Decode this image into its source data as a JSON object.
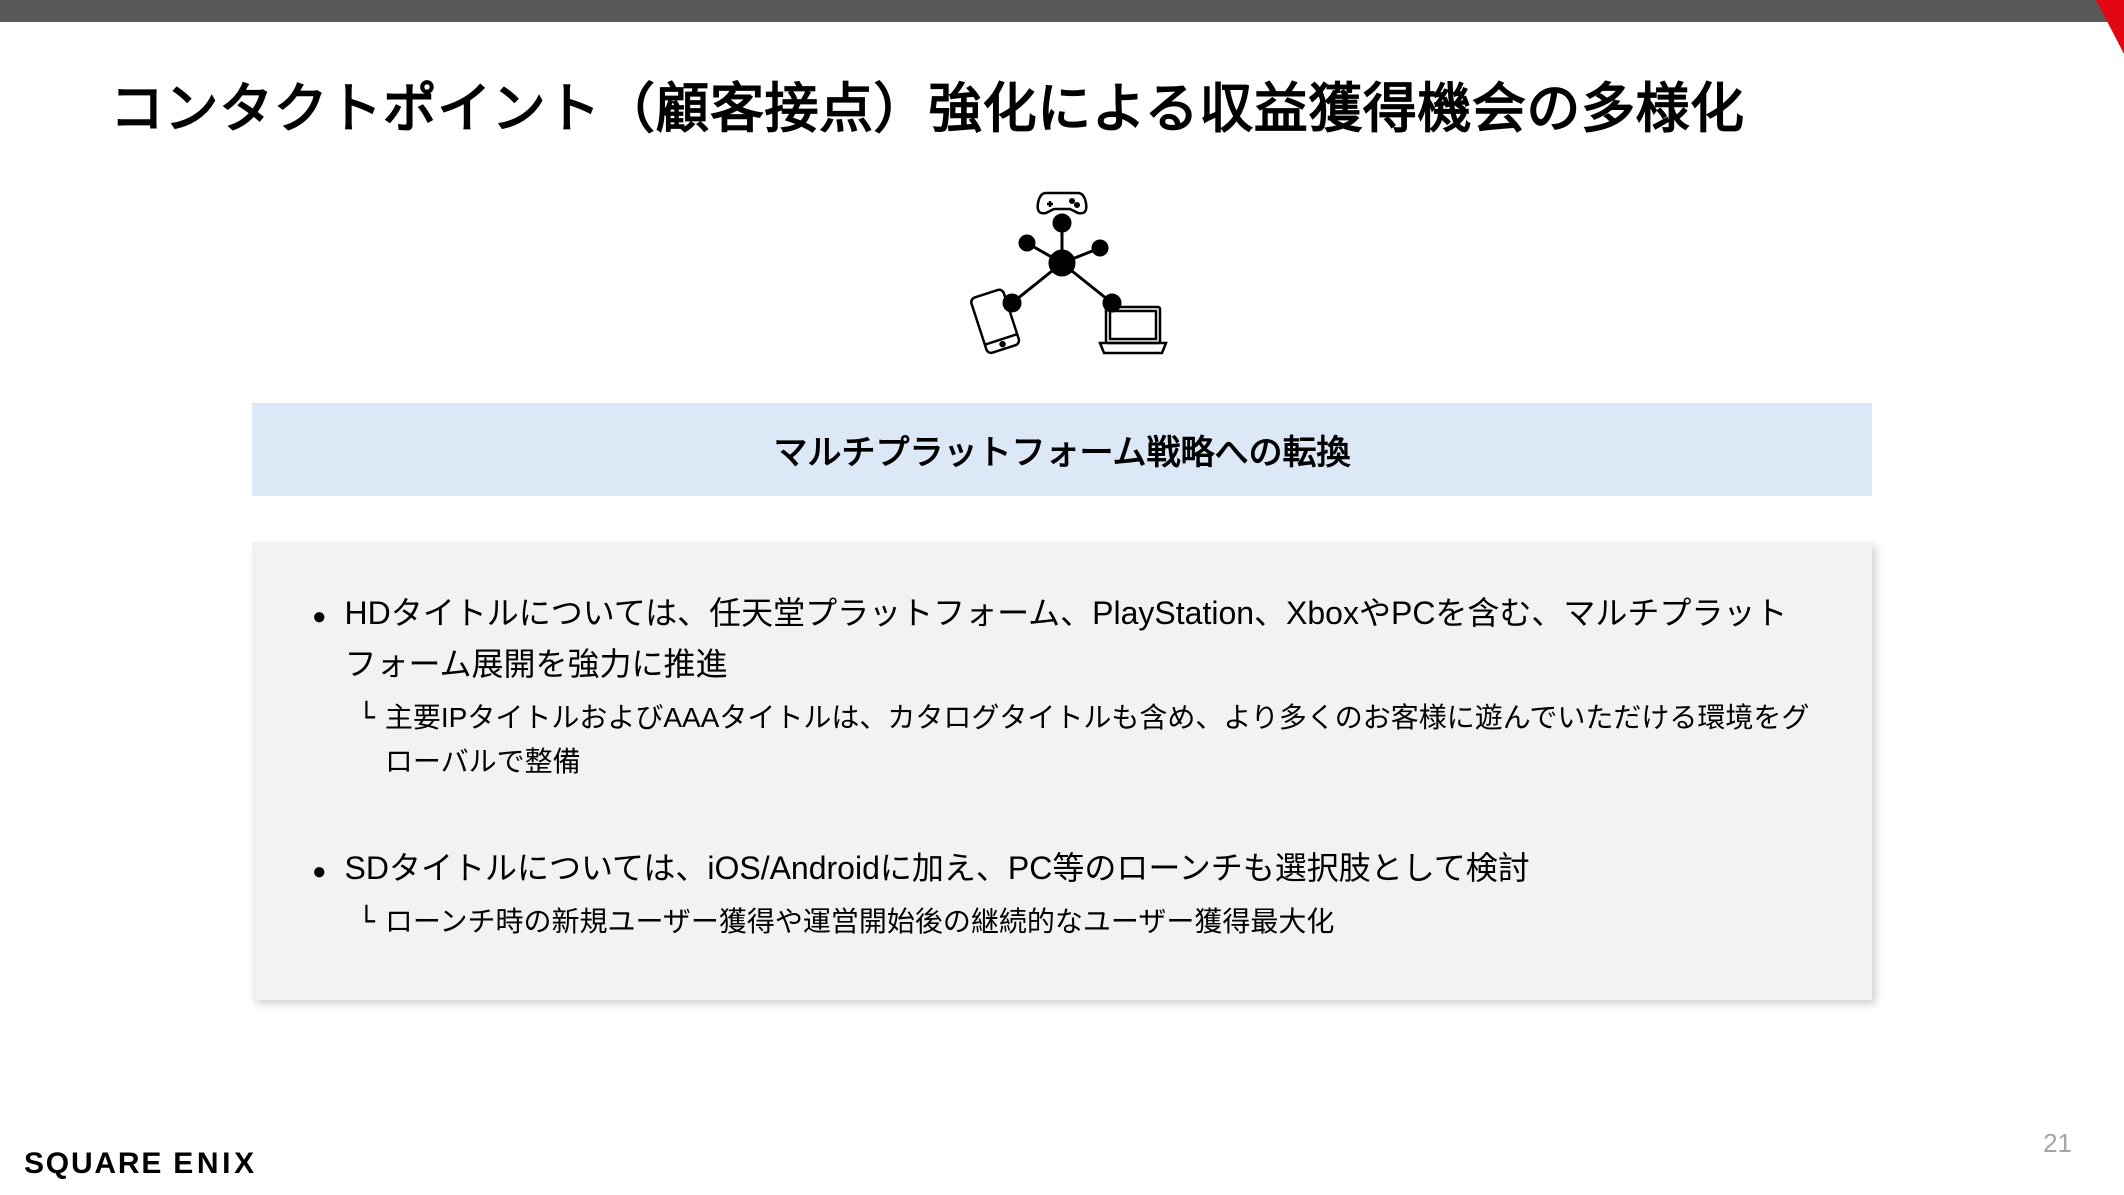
{
  "slide": {
    "title": "コンタクトポイント（顧客接点）強化による収益獲得機会の多様化",
    "banner": "マルチプラットフォーム戦略への転換",
    "bullets": [
      {
        "text": "HDタイトルについては、任天堂プラットフォーム、PlayStation、XboxやPCを含む、マルチプラットフォーム展開を強力に推進",
        "sub": "主要IPタイトルおよびAAAタイトルは、カタログタイトルも含め、より多くのお客様に遊んでいただける環境をグローバルで整備"
      },
      {
        "text": "SDタイトルについては、iOS/Androidに加え、PC等のローンチも選択肢として検討",
        "sub": "ローンチ時の新規ユーザー獲得や運営開始後の継続的なユーザー獲得最大化"
      }
    ],
    "page_number": "21",
    "brand": "SQUARE ENIX"
  },
  "icons": {
    "controller": "game-controller-icon",
    "phone": "smartphone-icon",
    "laptop": "laptop-icon",
    "hub": "network-hub-icon"
  }
}
